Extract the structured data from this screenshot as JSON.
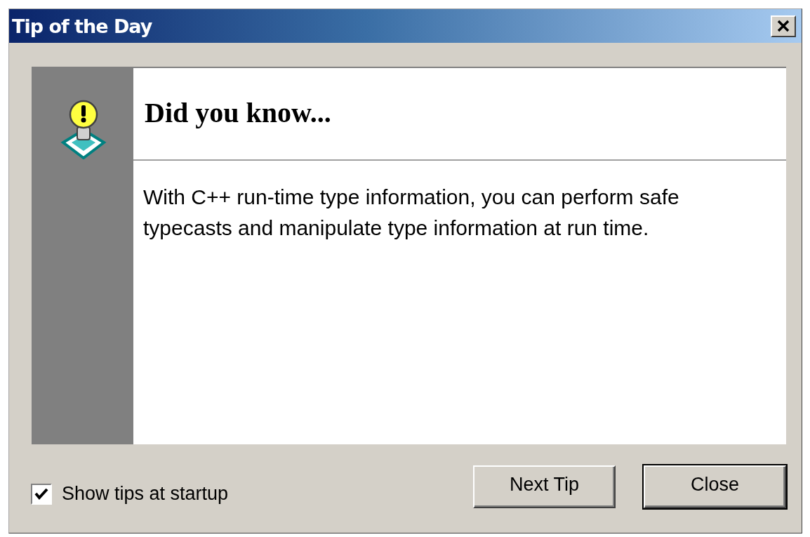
{
  "window": {
    "title": "Tip of the Day"
  },
  "tip": {
    "heading": "Did you know...",
    "text": "With C++ run-time type information, you can perform safe typecasts and manipulate type information at run time."
  },
  "show_at_startup": {
    "label": "Show tips at startup",
    "checked": true
  },
  "buttons": [
    {
      "label": "Next Tip",
      "default": false
    },
    {
      "label": "Close",
      "default": true
    }
  ]
}
